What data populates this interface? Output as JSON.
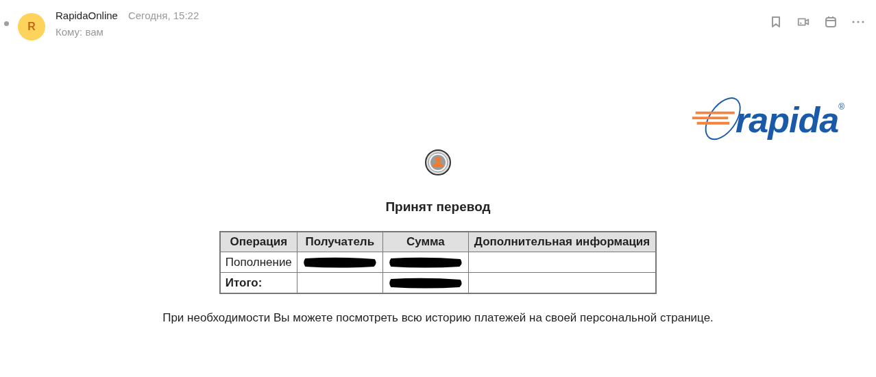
{
  "message": {
    "unread": true,
    "avatar_letter": "R",
    "sender": "RapidaOnline",
    "date": "Сегодня, 15:22",
    "to": "Кому: вам"
  },
  "logo": {
    "text": "rapida",
    "mark": "®"
  },
  "title": "Принят перевод",
  "table": {
    "columns": [
      "Операция",
      "Получатель",
      "Сумма",
      "Дополнительная информация"
    ],
    "rows": [
      {
        "cells": [
          {
            "kind": "text",
            "text": "Пополнение",
            "bold": false
          },
          {
            "kind": "redacted"
          },
          {
            "kind": "redacted"
          },
          {
            "kind": "empty"
          }
        ]
      },
      {
        "cells": [
          {
            "kind": "text",
            "text": "Итого:",
            "bold": true
          },
          {
            "kind": "empty"
          },
          {
            "kind": "redacted"
          },
          {
            "kind": "empty"
          }
        ]
      }
    ]
  },
  "note": "При необходимости Вы можете посмотреть всю историю платежей на своей персональной странице."
}
